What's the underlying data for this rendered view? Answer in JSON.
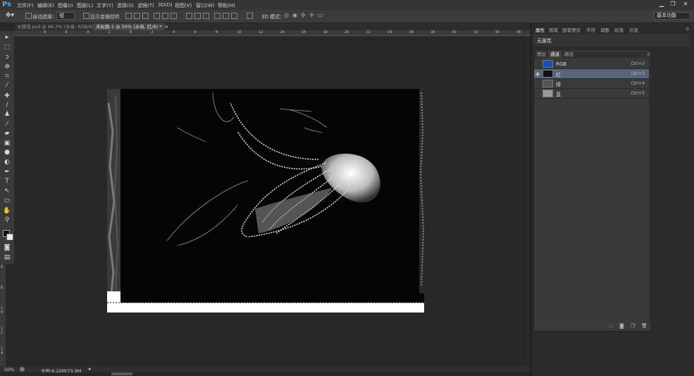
{
  "app": {
    "logo": "Ps"
  },
  "menu": [
    "文件(F)",
    "编辑(E)",
    "图像(I)",
    "图层(L)",
    "文字(Y)",
    "选择(S)",
    "滤镜(T)",
    "3D(D)",
    "视图(V)",
    "窗口(W)",
    "帮助(H)"
  ],
  "window_controls": {
    "minimize": "▁",
    "restore": "❐",
    "close": "✕"
  },
  "options": {
    "auto_select_label": "自动选择：",
    "auto_select_value": "组",
    "show_transform_label": "显示变换控件",
    "mode_3d_label": "3D 模式：",
    "workspace": "基本功能"
  },
  "tabs": [
    {
      "label": "水族馆.psd @ 66.7% (水母, RGB/8) *",
      "close": "×"
    },
    {
      "label": "未标题-1 @ 50% (水母, 红/8) *",
      "close": "×"
    }
  ],
  "ruler_h": [
    "8",
    "6",
    "4",
    "2",
    "0",
    "2",
    "4",
    "6",
    "8",
    "10",
    "12",
    "14",
    "16",
    "18",
    "20",
    "22",
    "24",
    "26",
    "28",
    "30",
    "32",
    "34",
    "36"
  ],
  "ruler_v": [
    "6",
    "8",
    "1 0",
    "1 2",
    "1 4"
  ],
  "status": {
    "zoom": "50%",
    "doc": "文档:6.22M/73.9M"
  },
  "property_tabs": [
    "属性",
    "画笔",
    "画笔预设",
    "字符",
    "调整",
    "段落",
    "信息"
  ],
  "property_empty": "无属性",
  "channel_tabs": [
    "图层",
    "通道",
    "路径"
  ],
  "channels": [
    {
      "name": "RGB",
      "shortcut": "Ctrl+2",
      "visible": false,
      "selected": false
    },
    {
      "name": "红",
      "shortcut": "Ctrl+3",
      "visible": true,
      "selected": true
    },
    {
      "name": "绿",
      "shortcut": "Ctrl+4",
      "visible": false,
      "selected": false
    },
    {
      "name": "蓝",
      "shortcut": "Ctrl+5",
      "visible": false,
      "selected": false
    }
  ],
  "colors": {
    "accent": "#4fa3e6",
    "selected_row": "#5a6478"
  }
}
